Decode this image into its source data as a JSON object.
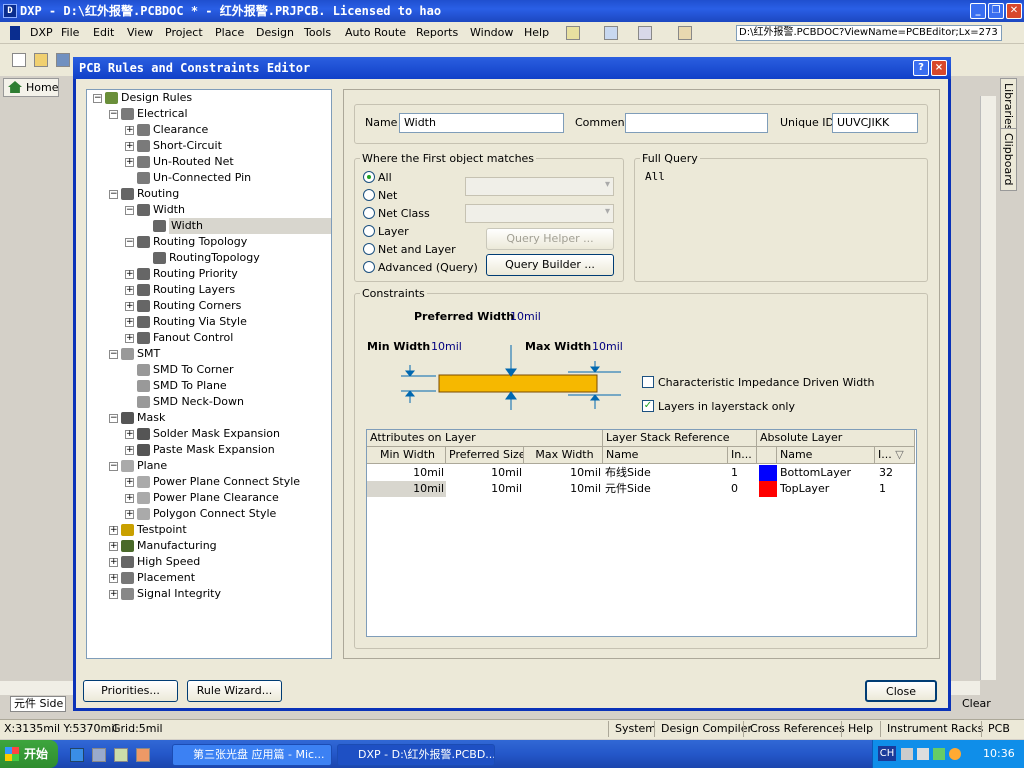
{
  "app": {
    "title": "DXP - D:\\红外报警.PCBDOC * - 红外报警.PRJPCB. Licensed to hao",
    "logo": "DXP",
    "path": "D:\\红外报警.PCBDOC?ViewName=PCBEditor;Lx=273"
  },
  "menu": [
    "DXP",
    "File",
    "Edit",
    "View",
    "Project",
    "Place",
    "Design",
    "Tools",
    "Auto Route",
    "Reports",
    "Window",
    "Help"
  ],
  "home_label": "Home",
  "side_tabs": [
    "Libraries",
    "Clipboard"
  ],
  "dialog": {
    "title": "PCB Rules and Constraints Editor",
    "help_glyph": "?",
    "close_glyph": "×"
  },
  "tree": [
    {
      "label": "Design Rules",
      "level": 0,
      "expander": "−",
      "icon": "rules"
    },
    {
      "label": "Electrical",
      "level": 1,
      "expander": "−",
      "icon": "elec"
    },
    {
      "label": "Clearance",
      "level": 2,
      "expander": "+",
      "icon": "elec"
    },
    {
      "label": "Short-Circuit",
      "level": 2,
      "expander": "+",
      "icon": "elec"
    },
    {
      "label": "Un-Routed Net",
      "level": 2,
      "expander": "+",
      "icon": "elec"
    },
    {
      "label": "Un-Connected Pin",
      "level": 2,
      "expander": "",
      "icon": "elec"
    },
    {
      "label": "Routing",
      "level": 1,
      "expander": "−",
      "icon": "route"
    },
    {
      "label": "Width",
      "level": 2,
      "expander": "−",
      "icon": "route"
    },
    {
      "label": "Width",
      "level": 3,
      "expander": "",
      "icon": "route",
      "selected": true
    },
    {
      "label": "Routing Topology",
      "level": 2,
      "expander": "−",
      "icon": "route"
    },
    {
      "label": "RoutingTopology",
      "level": 3,
      "expander": "",
      "icon": "route"
    },
    {
      "label": "Routing Priority",
      "level": 2,
      "expander": "+",
      "icon": "route"
    },
    {
      "label": "Routing Layers",
      "level": 2,
      "expander": "+",
      "icon": "route"
    },
    {
      "label": "Routing Corners",
      "level": 2,
      "expander": "+",
      "icon": "route"
    },
    {
      "label": "Routing Via Style",
      "level": 2,
      "expander": "+",
      "icon": "route"
    },
    {
      "label": "Fanout Control",
      "level": 2,
      "expander": "+",
      "icon": "route"
    },
    {
      "label": "SMT",
      "level": 1,
      "expander": "−",
      "icon": "smt"
    },
    {
      "label": "SMD To Corner",
      "level": 2,
      "expander": "",
      "icon": "smt"
    },
    {
      "label": "SMD To Plane",
      "level": 2,
      "expander": "",
      "icon": "smt"
    },
    {
      "label": "SMD Neck-Down",
      "level": 2,
      "expander": "",
      "icon": "smt"
    },
    {
      "label": "Mask",
      "level": 1,
      "expander": "−",
      "icon": "mask"
    },
    {
      "label": "Solder Mask Expansion",
      "level": 2,
      "expander": "+",
      "icon": "mask"
    },
    {
      "label": "Paste Mask Expansion",
      "level": 2,
      "expander": "+",
      "icon": "mask"
    },
    {
      "label": "Plane",
      "level": 1,
      "expander": "−",
      "icon": "plane"
    },
    {
      "label": "Power Plane Connect Style",
      "level": 2,
      "expander": "+",
      "icon": "plane"
    },
    {
      "label": "Power Plane Clearance",
      "level": 2,
      "expander": "+",
      "icon": "plane"
    },
    {
      "label": "Polygon Connect Style",
      "level": 2,
      "expander": "+",
      "icon": "plane"
    },
    {
      "label": "Testpoint",
      "level": 1,
      "expander": "+",
      "icon": "test"
    },
    {
      "label": "Manufacturing",
      "level": 1,
      "expander": "+",
      "icon": "mfg"
    },
    {
      "label": "High Speed",
      "level": 1,
      "expander": "+",
      "icon": "hs"
    },
    {
      "label": "Placement",
      "level": 1,
      "expander": "+",
      "icon": "place"
    },
    {
      "label": "Signal Integrity",
      "level": 1,
      "expander": "+",
      "icon": "si"
    }
  ],
  "rule": {
    "name_label": "Name",
    "name": "Width",
    "comment_label": "Comment",
    "comment": "",
    "uid_label": "Unique ID",
    "uid": "UUVCJIKK"
  },
  "match": {
    "title": "Where the First object matches",
    "options": [
      "All",
      "Net",
      "Net Class",
      "Layer",
      "Net and Layer",
      "Advanced (Query)"
    ],
    "selected": 0,
    "query_helper": "Query Helper ...",
    "query_builder": "Query Builder ..."
  },
  "full_query": {
    "title": "Full Query",
    "text": "All"
  },
  "constraints": {
    "title": "Constraints",
    "preferred_label": "Preferred Width",
    "preferred_value": "10mil",
    "min_label": "Min Width",
    "min_value": "10mil",
    "max_label": "Max Width",
    "max_value": "10mil",
    "impedance_label": "Characteristic Impedance Driven Width",
    "impedance_checked": false,
    "layerstack_label": "Layers in layerstack only",
    "layerstack_checked": true,
    "check_glyph": "✓"
  },
  "grid": {
    "group_headers": [
      "Attributes on Layer",
      "Layer Stack Reference",
      "Absolute Layer"
    ],
    "headers": [
      "Min Width",
      "Preferred Size",
      "Max Width",
      "Name",
      "In...",
      "",
      "Name",
      "I..."
    ],
    "sort_glyph": "▽",
    "rows": [
      {
        "min": "10mil",
        "pref": "10mil",
        "max": "10mil",
        "stack_name": "布线Side",
        "index": "1",
        "color": "#0000ff",
        "layer": "BottomLayer",
        "layer_id": "32"
      },
      {
        "min": "10mil",
        "pref": "10mil",
        "max": "10mil",
        "stack_name": "元件Side",
        "index": "0",
        "color": "#ff0000",
        "layer": "TopLayer",
        "layer_id": "1"
      }
    ]
  },
  "buttons": {
    "priorities": "Priorities...",
    "wizard": "Rule Wizard...",
    "close": "Close"
  },
  "status": {
    "coords": "X:3135mil Y:5370mil",
    "grid": "Grid:5mil",
    "tabs": [
      "System",
      "Design Compiler",
      "Cross References",
      "Help",
      "Instrument Racks",
      "PCB"
    ],
    "layer_tab": "元件 Side",
    "clear": "Clear"
  },
  "taskbar": {
    "start": "开始",
    "tasks": [
      "第三张光盘 应用篇 - Mic...",
      "DXP - D:\\红外报警.PCBD..."
    ],
    "lang": "CH",
    "time": "10:36"
  }
}
